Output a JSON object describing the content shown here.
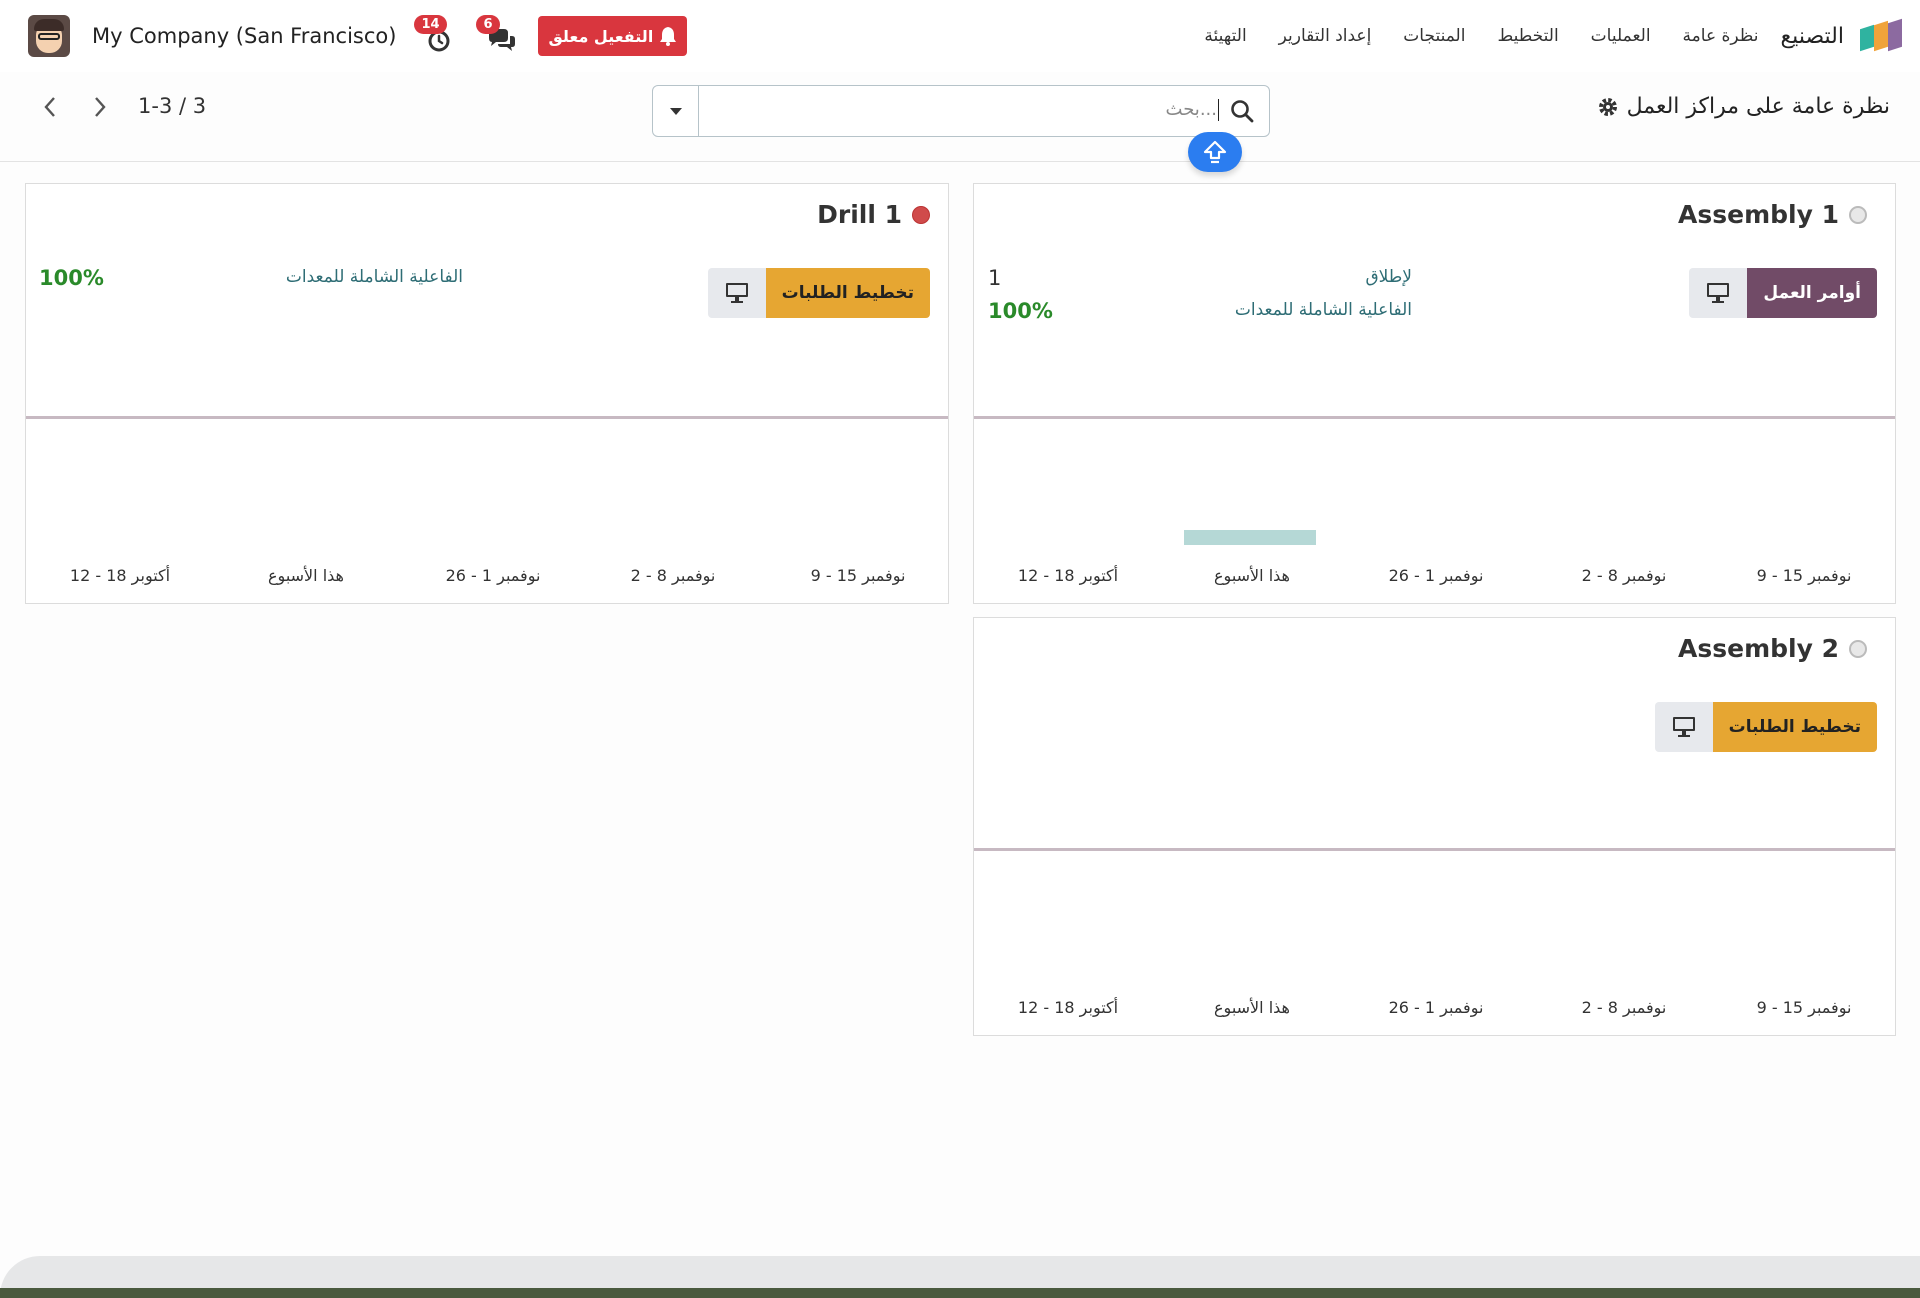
{
  "navbar": {
    "app_name": "التصنيع",
    "menu": [
      "نظرة عامة",
      "العمليات",
      "التخطيط",
      "المنتجات",
      "إعداد التقارير",
      "التهيئة"
    ],
    "activation_label": "التفعيل معلق",
    "messages_count": "6",
    "activities_count": "14",
    "company": "My Company (San Francisco)"
  },
  "control": {
    "title": "نظرة عامة على مراكز العمل",
    "search_placeholder": "بحث...",
    "pager": "1-3 / 3"
  },
  "cards": [
    {
      "name": "Assembly 1",
      "status": "grey",
      "button_label": "أوامر العمل",
      "stats": [
        {
          "label": "لإطلاق",
          "value": "1"
        },
        {
          "label": "الفاعلية الشاملة للمعدات",
          "value": "100%"
        }
      ],
      "chart_ticks": [
        "9 - 15 نوفمبر",
        "2 - 8 نوفمبر",
        "26 - 1 نوفمبر",
        "هذا الأسبوع",
        "12 - 18 أكتوبر"
      ]
    },
    {
      "name": "Drill 1",
      "status": "red",
      "button_label": "تخطيط الطلبات",
      "stats": [
        {
          "label": "الفاعلية الشاملة للمعدات",
          "value": "100%"
        }
      ],
      "chart_ticks": [
        "9 - 15 نوفمبر",
        "2 - 8 نوفمبر",
        "26 - 1 نوفمبر",
        "هذا الأسبوع",
        "12 - 18 أكتوبر"
      ]
    },
    {
      "name": "Assembly 2",
      "status": "grey",
      "button_label": "تخطيط الطلبات",
      "stats": [],
      "chart_ticks": [
        "9 - 15 نوفمبر",
        "2 - 8 نوفمبر",
        "26 - 1 نوفمبر",
        "هذا الأسبوع",
        "12 - 18 أكتوبر"
      ]
    }
  ],
  "colors": {
    "brand_purple": "#714b67",
    "orange": "#e6a632",
    "danger": "#d9363e",
    "toggle_blue": "#2b7df0"
  }
}
